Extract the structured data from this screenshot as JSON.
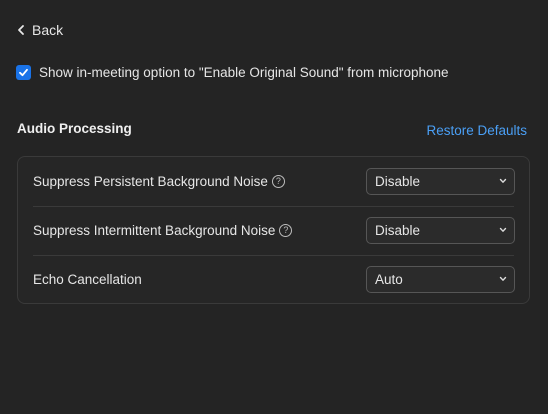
{
  "nav": {
    "back_label": "Back"
  },
  "options": {
    "original_sound_label": "Show in-meeting option to \"Enable Original Sound\" from microphone",
    "original_sound_checked": true
  },
  "audio_processing": {
    "title": "Audio Processing",
    "restore_label": "Restore Defaults",
    "settings": [
      {
        "label": "Suppress Persistent Background Noise",
        "has_help": true,
        "value": "Disable"
      },
      {
        "label": "Suppress Intermittent Background Noise",
        "has_help": true,
        "value": "Disable"
      },
      {
        "label": "Echo Cancellation",
        "has_help": false,
        "value": "Auto"
      }
    ]
  },
  "help_glyph": "?",
  "colors": {
    "background": "#242424",
    "accent": "#1a73e8",
    "link": "#4a9ff5"
  }
}
